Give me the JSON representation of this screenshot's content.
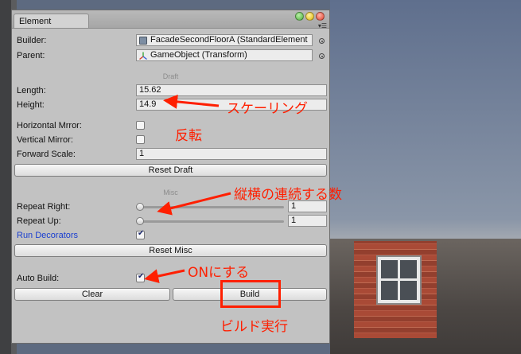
{
  "window": {
    "tab_label": "Element"
  },
  "fields": {
    "builder_label": "Builder:",
    "builder_value": "FacadeSecondFloorA (StandardElement",
    "parent_label": "Parent:",
    "parent_value": "GameObject (Transform)"
  },
  "draft": {
    "header": "Draft",
    "length_label": "Length:",
    "length_value": "15.62",
    "height_label": "Height:",
    "height_value": "14.9",
    "hmirror_label": "Horizontal Mrror:",
    "hmirror_checked": false,
    "vmirror_label": "Vertical Mirror:",
    "vmirror_checked": false,
    "forward_label": "Forward Scale:",
    "forward_value": "1",
    "reset_label": "Reset Draft"
  },
  "misc": {
    "header": "Misc",
    "repeat_right_label": "Repeat Right:",
    "repeat_right_value": "1",
    "repeat_up_label": "Repeat Up:",
    "repeat_up_value": "1",
    "run_decorators_label": "Run Decorators",
    "run_decorators_checked": true,
    "reset_label": "Reset Misc"
  },
  "build": {
    "auto_build_label": "Auto Build:",
    "auto_build_checked": true,
    "clear_label": "Clear",
    "build_label": "Build"
  },
  "annotations": {
    "scaling": "スケーリング",
    "flip": "反転",
    "repeat_count": "縦横の連続する数",
    "turn_on": "ONにする",
    "run_build": "ビルド実行"
  },
  "colors": {
    "annotation": "#ff1f00",
    "panel": "#c2c2c2",
    "link_blue": "#1a3fd0"
  },
  "icons": {
    "builder_field": "scriptable-object-icon",
    "parent_field": "transform-axes-icon",
    "object_picker": "target-circle-icon"
  }
}
